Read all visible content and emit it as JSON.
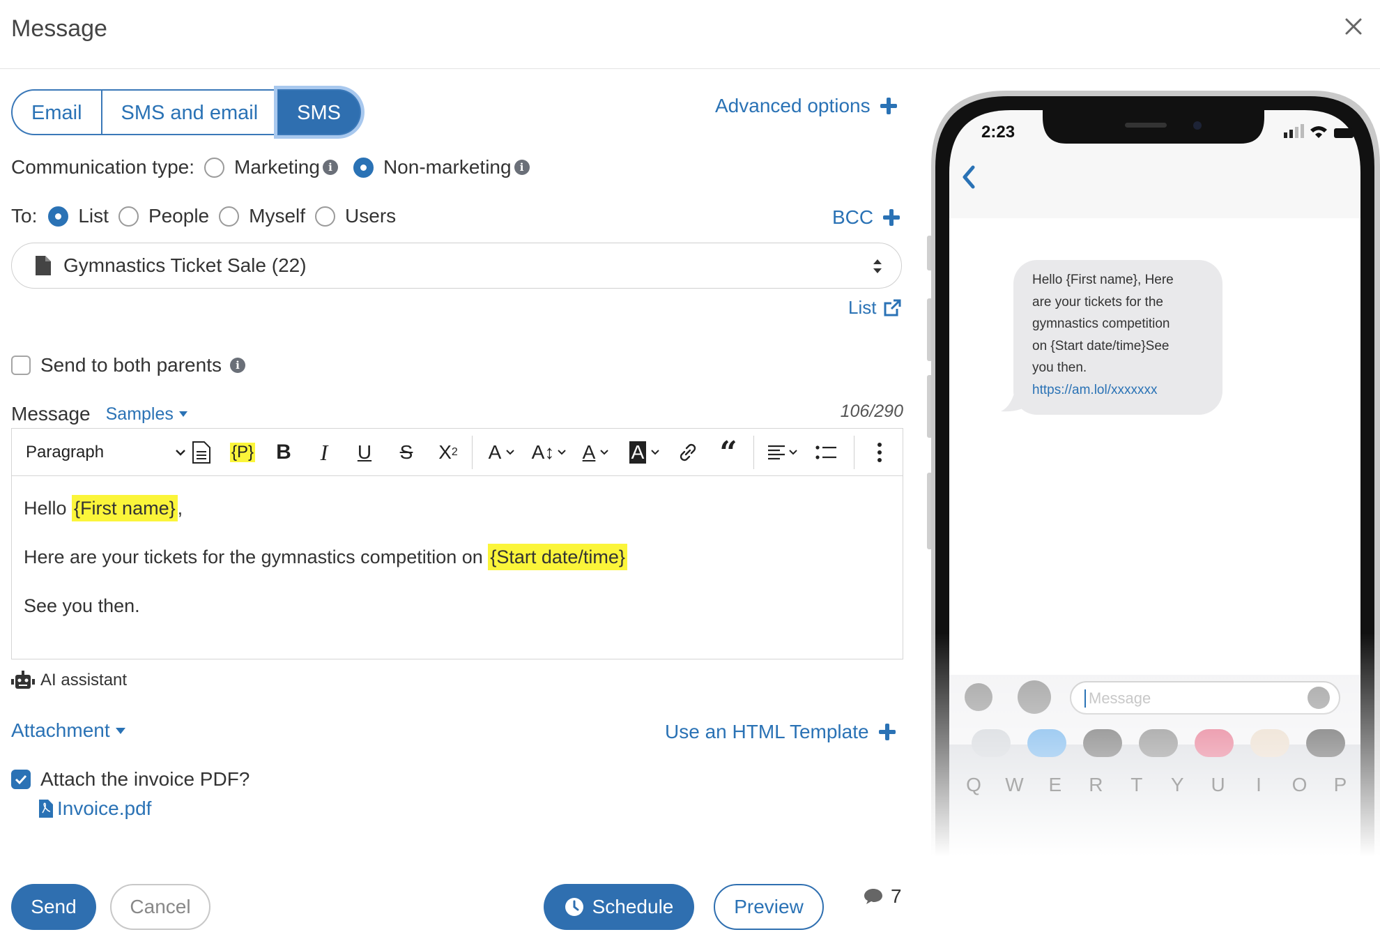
{
  "header": {
    "title": "Message"
  },
  "channel_tabs": [
    "Email",
    "SMS and email",
    "SMS"
  ],
  "advanced_options": "Advanced options",
  "communication": {
    "label": "Communication type:",
    "options": [
      "Marketing",
      "Non-marketing"
    ],
    "selected": "Non-marketing"
  },
  "recipients": {
    "label": "To:",
    "options": [
      "List",
      "People",
      "Myself",
      "Users"
    ],
    "selected": "List",
    "bcc": "BCC"
  },
  "list_select": {
    "value": "Gymnastics Ticket Sale (22)"
  },
  "list_link": "List",
  "send_both_parents": {
    "label": "Send to both parents",
    "checked": false
  },
  "message": {
    "label": "Message",
    "samples": "Samples",
    "counter": "106/290",
    "paragraph_style": "Paragraph",
    "placeholder_button": "{P}",
    "line1_prefix": "Hello",
    "line1_token": "{First name}",
    "line1_suffix": ",",
    "line2_prefix": "Here are your tickets for the gymnastics competition on",
    "line2_token": "{Start date/time}",
    "line3": "See you then."
  },
  "ai_assistant": "AI assistant",
  "attachment": {
    "label": "Attachment",
    "html_template": "Use an HTML Template"
  },
  "invoice": {
    "label": "Attach the invoice PDF?",
    "checked": true,
    "file": "Invoice.pdf"
  },
  "actions": {
    "send": "Send",
    "cancel": "Cancel",
    "schedule": "Schedule",
    "preview": "Preview",
    "sms_count": "7"
  },
  "phone_preview": {
    "time": "2:23",
    "bubble_lines": [
      "Hello {First name}, Here",
      "are your tickets for the",
      "gymnastics competition",
      "on {Start date/time}See",
      "you then."
    ],
    "bubble_link": "https://am.lol/xxxxxxx",
    "input_placeholder": "Message",
    "keyboard_row": [
      "Q",
      "W",
      "E",
      "R",
      "T",
      "Y",
      "U",
      "I",
      "O",
      "P"
    ]
  },
  "colors": {
    "accent": "#2f6fb0",
    "highlight": "#fbf53a",
    "link": "#2a72b5"
  }
}
